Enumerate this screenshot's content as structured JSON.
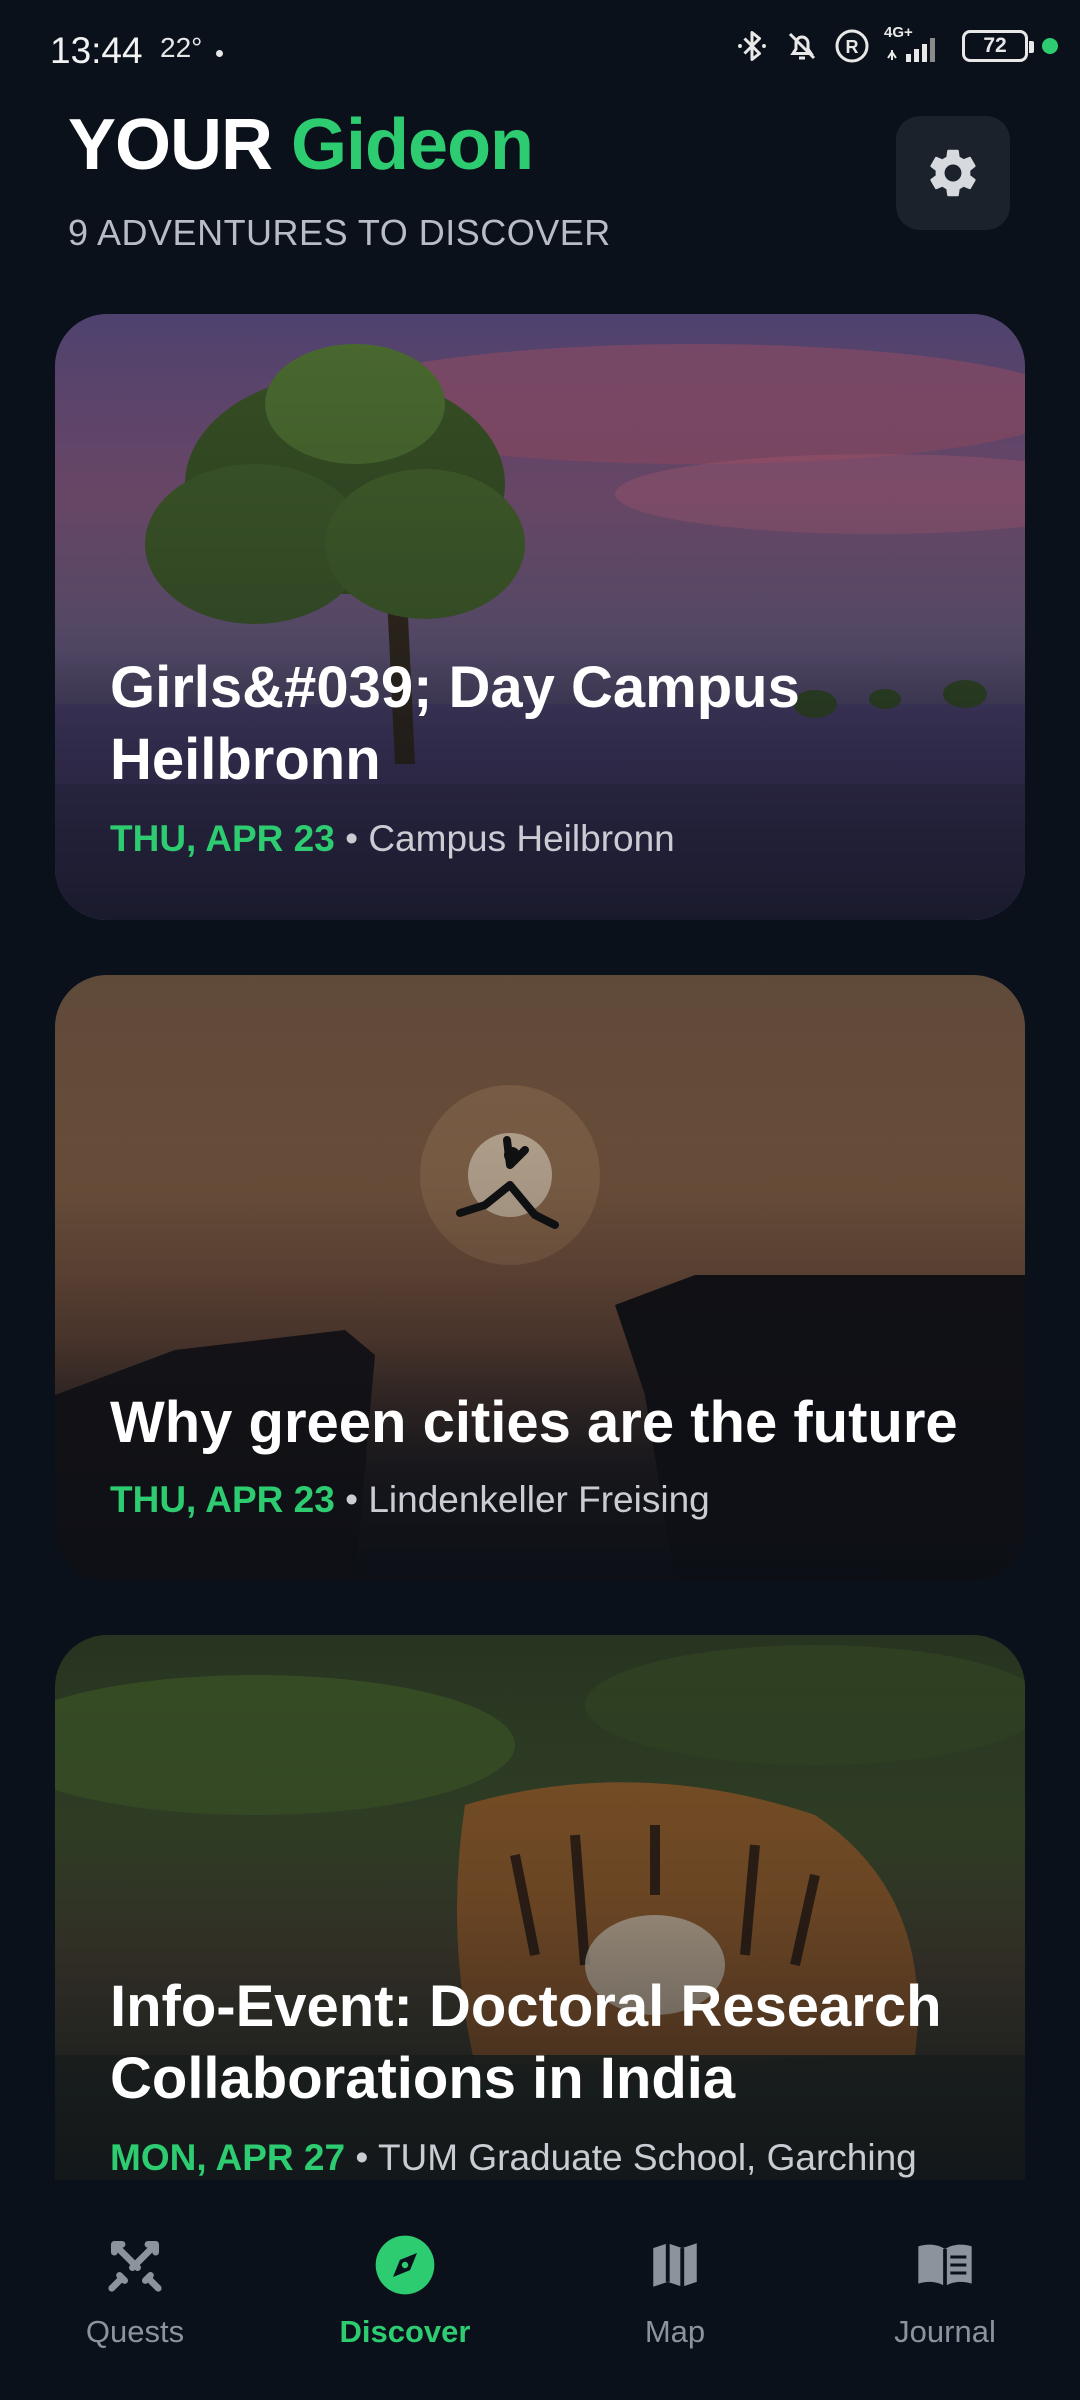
{
  "status_bar": {
    "time": "13:44",
    "temperature": "22°",
    "network": "4G+",
    "battery": "72"
  },
  "header": {
    "title_prefix": "YOUR",
    "title_name": "Gideon",
    "subtitle": "9 ADVENTURES TO DISCOVER"
  },
  "cards": [
    {
      "title": "Girls&#039; Day Campus Heilbronn",
      "date": "THU, APR 23",
      "separator": "•",
      "location": "Campus Heilbronn"
    },
    {
      "title": "Why green cities are the future",
      "date": "THU, APR 23",
      "separator": "•",
      "location": "Lindenkeller Freising"
    },
    {
      "title": "Info-Event: Doctoral Research Collaborations in India",
      "date": "MON, APR 27",
      "separator": "•",
      "location": "TUM Graduate School, Garching"
    }
  ],
  "nav": [
    {
      "label": "Quests",
      "icon": "crossed-swords-icon",
      "active": false
    },
    {
      "label": "Discover",
      "icon": "compass-icon",
      "active": true
    },
    {
      "label": "Map",
      "icon": "map-icon",
      "active": false
    },
    {
      "label": "Journal",
      "icon": "open-book-icon",
      "active": false
    }
  ],
  "colors": {
    "background": "#0b111b",
    "accent": "#2ecc71",
    "muted": "#8c939d"
  }
}
